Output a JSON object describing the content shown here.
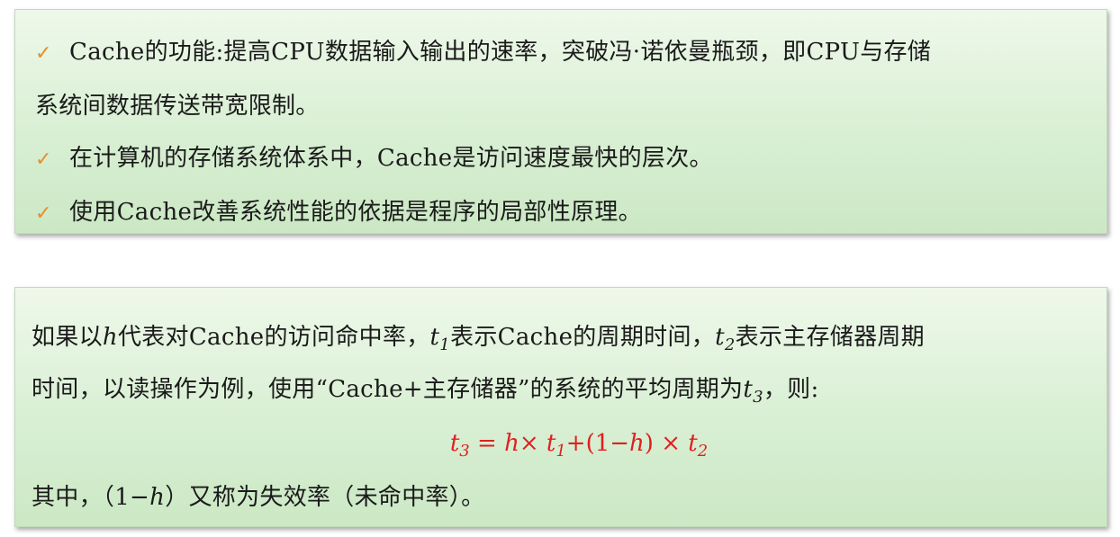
{
  "box1": {
    "check_glyph": "✓",
    "item1_line1": "Cache的功能:提高CPU数据输入输出的速率，突破冯·诺依曼瓶颈，即CPU与存储",
    "item1_line2": "系统间数据传送带宽限制。",
    "item2": "在计算机的存储系统体系中，Cache是访问速度最快的层次。",
    "item3": "使用Cache改善系统性能的依据是程序的局部性原理。"
  },
  "box2": {
    "p1_a": "如果以",
    "h": "h",
    "p1_b": "代表对Cache的访问命中率，",
    "t": "t",
    "sub1": "1",
    "p1_c": "表示Cache的周期时间，",
    "sub2": "2",
    "p1_d": "表示主存储器周期",
    "p2_a": "时间，以读操作为例，使用“Cache+主存储器”的系统的平均周期为",
    "sub3": "3",
    "p2_b": "，则:",
    "formula": {
      "lhs": "t",
      "lhs_sub": "3",
      "eq": " = ",
      "h": "h",
      "times1": "× ",
      "t1": "t",
      "t1_sub": "1",
      "plus": "+(1−",
      "h2": "h",
      "close_times": ") × ",
      "t2": "t",
      "t2_sub": "2"
    },
    "p3_a": "其中，（1−",
    "p3_h": "h",
    "p3_b": "）又称为失效率（未命中率）。"
  },
  "colors": {
    "check": "#e88d2c",
    "formula": "#e02020",
    "box_bg": "#d9efd4"
  }
}
